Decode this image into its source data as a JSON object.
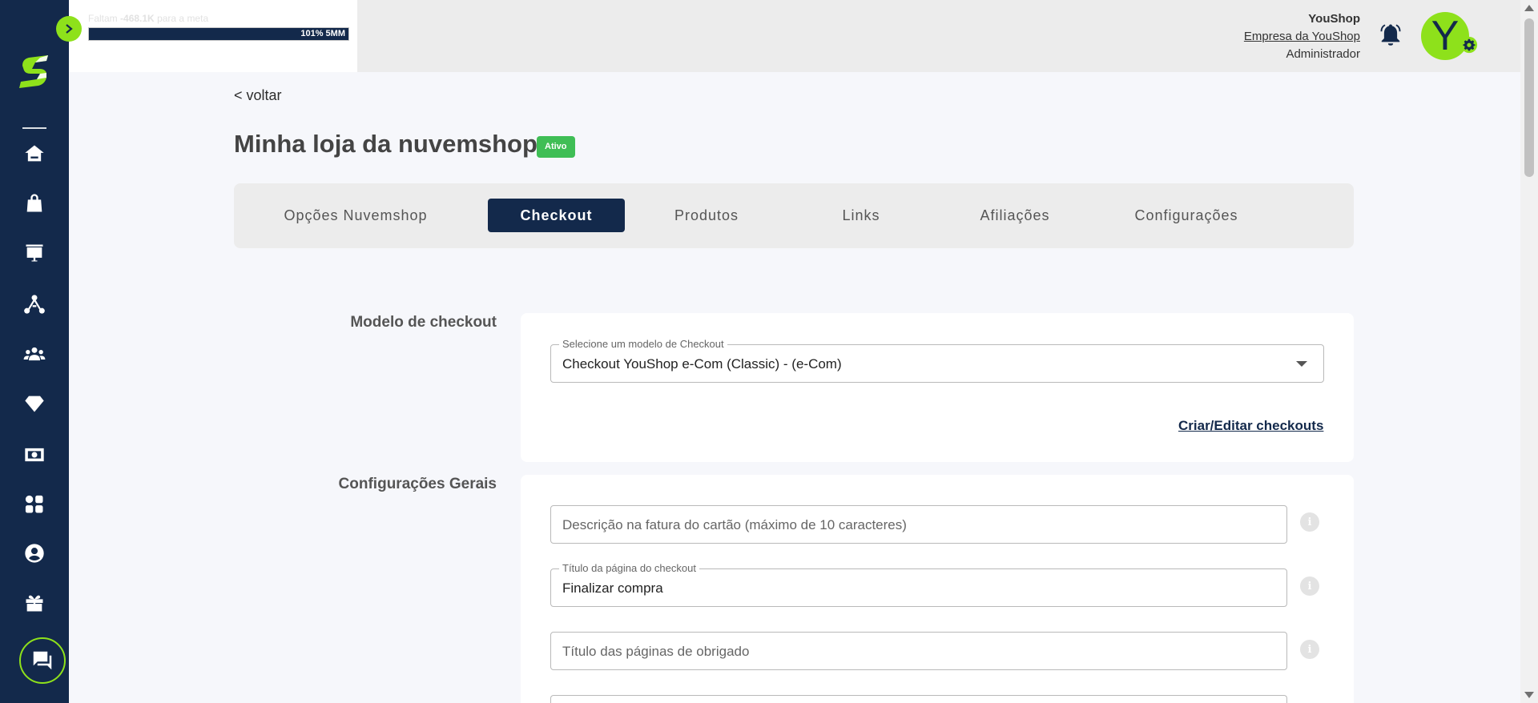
{
  "sidebar": {
    "items": [
      {
        "icon": "home-icon"
      },
      {
        "icon": "shopping-bag-icon"
      },
      {
        "icon": "chart-board-icon"
      },
      {
        "icon": "network-icon"
      },
      {
        "icon": "users-icon"
      },
      {
        "icon": "diamond-icon"
      },
      {
        "icon": "money-icon"
      },
      {
        "icon": "apps-icon"
      },
      {
        "icon": "user-circle-icon"
      },
      {
        "icon": "gift-icon"
      }
    ],
    "chat_icon": "chat-icon",
    "expand_icon": "chevron-right-icon"
  },
  "goal": {
    "text_prefix": "Faltam",
    "text_amount": "-468.1K",
    "text_suffix": "para a meta",
    "bar_label_left": "101%",
    "bar_label_right": "5MM",
    "progress_percent": 101
  },
  "user": {
    "name": "YouShop",
    "company": "Empresa da YouShop",
    "role": "Administrador",
    "avatar_letter": "Y"
  },
  "page": {
    "back": "< voltar",
    "title": "Minha loja da nuvemshop",
    "status": "Ativo"
  },
  "tabs": [
    {
      "label": "Opções Nuvemshop",
      "active": false
    },
    {
      "label": "Checkout",
      "active": true
    },
    {
      "label": "Produtos",
      "active": false
    },
    {
      "label": "Links",
      "active": false
    },
    {
      "label": "Afiliações",
      "active": false
    },
    {
      "label": "Configurações",
      "active": false
    }
  ],
  "checkout_model": {
    "section_label": "Modelo de checkout",
    "select_label": "Selecione um modelo de Checkout",
    "select_value": "Checkout YouShop e-Com (Classic) - (e-Com)",
    "edit_link": "Criar/Editar checkouts"
  },
  "general": {
    "section_label": "Configurações Gerais",
    "fields": [
      {
        "label": "",
        "placeholder": "Descrição na fatura do cartão (máximo de 10 caracteres)",
        "value": ""
      },
      {
        "label": "Título da página do checkout",
        "placeholder": "",
        "value": "Finalizar compra"
      },
      {
        "label": "",
        "placeholder": "Título das páginas de obrigado",
        "value": ""
      }
    ]
  },
  "colors": {
    "navy": "#13294b",
    "lime": "#8ee11b",
    "success": "#3fbe55"
  }
}
